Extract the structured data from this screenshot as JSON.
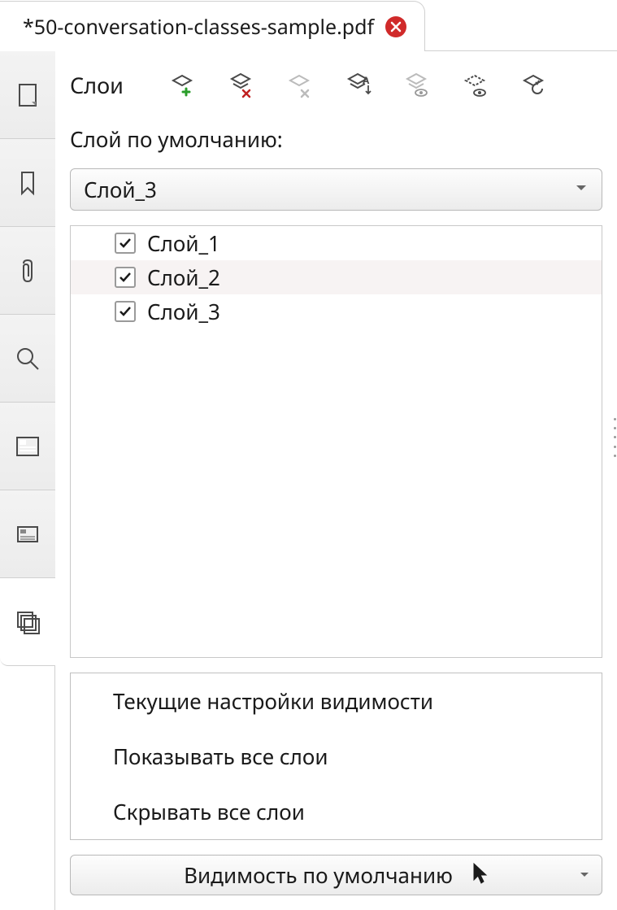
{
  "tab": {
    "title": "*50-conversation-classes-sample.pdf"
  },
  "sidebar": {
    "items": [
      {
        "name": "page-icon"
      },
      {
        "name": "bookmark-icon"
      },
      {
        "name": "attachment-icon"
      },
      {
        "name": "search-icon"
      },
      {
        "name": "optional-content-icon"
      },
      {
        "name": "properties-icon"
      },
      {
        "name": "layers-icon",
        "active": true
      }
    ]
  },
  "panel": {
    "title": "Слои",
    "toolbar": [
      {
        "name": "add-layer"
      },
      {
        "name": "delete-layer"
      },
      {
        "name": "remove-empty-layer"
      },
      {
        "name": "rename-layer"
      },
      {
        "name": "toggle-visibility"
      },
      {
        "name": "select-layer"
      },
      {
        "name": "reset-layer"
      }
    ],
    "default_label": "Слой по умолчанию:",
    "default_selected": "Слой_3",
    "layers": [
      {
        "name": "Слой_1",
        "checked": true
      },
      {
        "name": "Слой_2",
        "checked": true
      },
      {
        "name": "Слой_3",
        "checked": true
      }
    ],
    "visibility_menu": [
      "Текущие настройки видимости",
      "Показывать все слои",
      "Скрывать все слои"
    ],
    "visibility_button_label": "Видимость по умолчанию"
  }
}
